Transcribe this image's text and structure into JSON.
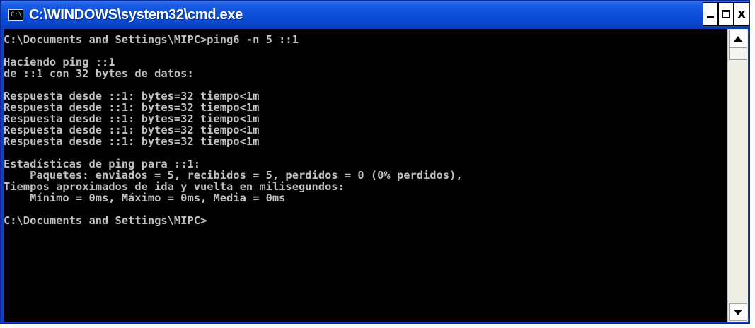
{
  "window": {
    "title": "C:\\WINDOWS\\system32\\cmd.exe",
    "icon_label": "C:\\"
  },
  "console": {
    "lines": [
      "C:\\Documents and Settings\\MIPC>ping6 -n 5 ::1",
      "",
      "Haciendo ping ::1",
      "de ::1 con 32 bytes de datos:",
      "",
      "Respuesta desde ::1: bytes=32 tiempo<1m",
      "Respuesta desde ::1: bytes=32 tiempo<1m",
      "Respuesta desde ::1: bytes=32 tiempo<1m",
      "Respuesta desde ::1: bytes=32 tiempo<1m",
      "Respuesta desde ::1: bytes=32 tiempo<1m",
      "",
      "Estadísticas de ping para ::1:",
      "    Paquetes: enviados = 5, recibidos = 5, perdidos = 0 (0% perdidos),",
      "Tiempos aproximados de ida y vuelta en milisegundos:",
      "    Mínimo = 0ms, Máximo = 0ms, Media = 0ms",
      "",
      "C:\\Documents and Settings\\MIPC>"
    ]
  },
  "colors": {
    "titlebar": "#0b4fd8",
    "console_bg": "#000000",
    "console_text": "#c0c0c0"
  },
  "icons": {
    "system": "cmd-icon",
    "minimize": "minimize-icon",
    "maximize": "maximize-icon",
    "close": "close-icon",
    "scroll_up": "arrow-up-icon",
    "scroll_down": "arrow-down-icon"
  },
  "buttons": {
    "close_label": "x"
  }
}
